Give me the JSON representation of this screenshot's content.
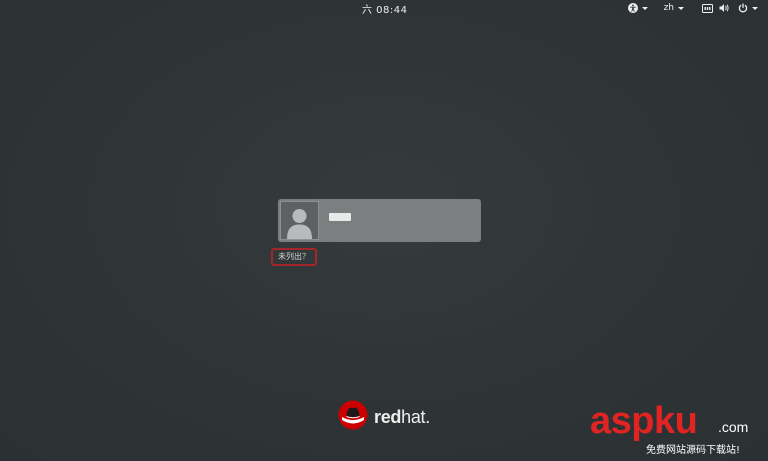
{
  "top_bar": {
    "clock": "六 08:44",
    "keyboard_layout": "zh",
    "icons": {
      "accessibility": "accessibility-icon",
      "network": "network-icon",
      "volume": "volume-icon",
      "power": "power-icon"
    }
  },
  "login": {
    "users": [
      {
        "name": "",
        "avatar": "user-avatar-icon"
      }
    ],
    "not_listed_label": "未列出？"
  },
  "branding": {
    "logo_text_bold": "red",
    "logo_text_light": "hat",
    "logo_text_suffix": ".",
    "logo_icon": "redhat-fedora-icon",
    "accent_color": "#cc0000"
  },
  "watermark": {
    "main": "aspku",
    "domain": ".com",
    "subtitle": "免费网站源码下载站!"
  },
  "colors": {
    "background": "#2e3436",
    "user_item": "#7b7f80",
    "focus_outline": "#a3262b"
  }
}
